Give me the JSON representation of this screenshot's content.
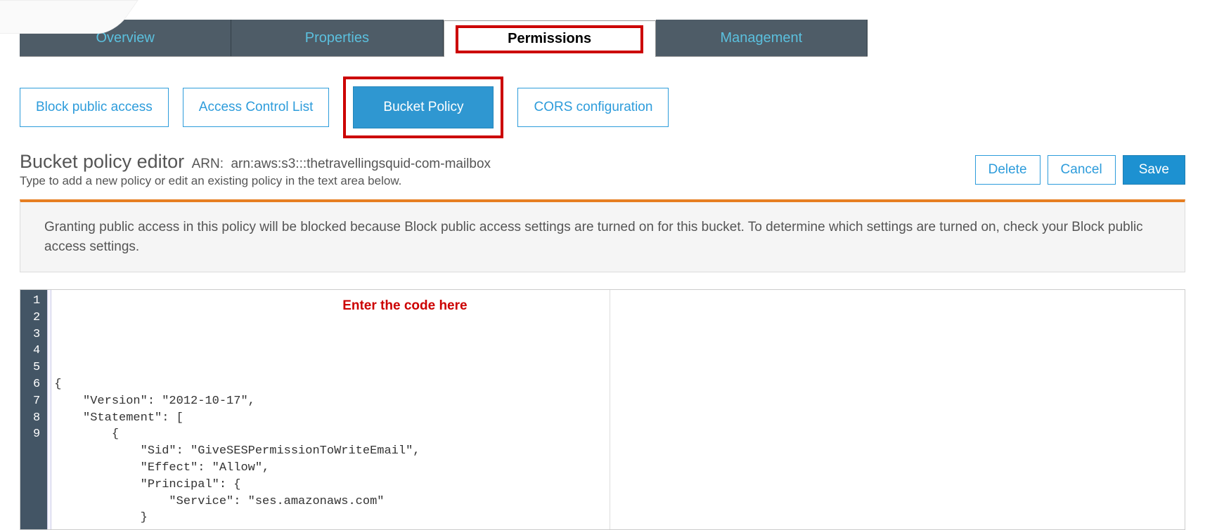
{
  "tabs": {
    "overview": "Overview",
    "properties": "Properties",
    "permissions": "Permissions",
    "management": "Management"
  },
  "subtabs": {
    "block": "Block public access",
    "acl": "Access Control List",
    "policy": "Bucket Policy",
    "cors": "CORS configuration"
  },
  "header": {
    "title": "Bucket policy editor",
    "arn_label": "ARN:",
    "arn_value": "arn:aws:s3:::thetravellingsquid-com-mailbox",
    "subtitle": "Type to add a new policy or edit an existing policy in the text area below."
  },
  "buttons": {
    "delete": "Delete",
    "cancel": "Cancel",
    "save": "Save"
  },
  "info_message": "Granting public access in this policy will be blocked because Block public access settings are turned on for this bucket. To determine which settings are turned on, check your Block public access settings.",
  "annotation": "Enter the code here",
  "editor": {
    "line_numbers": [
      "1",
      "2",
      "3",
      "4",
      "5",
      "6",
      "7",
      "8",
      "9"
    ],
    "lines": [
      "{",
      "    \"Version\": \"2012-10-17\",",
      "    \"Statement\": [",
      "        {",
      "            \"Sid\": \"GiveSESPermissionToWriteEmail\",",
      "            \"Effect\": \"Allow\",",
      "            \"Principal\": {",
      "                \"Service\": \"ses.amazonaws.com\"",
      "            }"
    ]
  }
}
